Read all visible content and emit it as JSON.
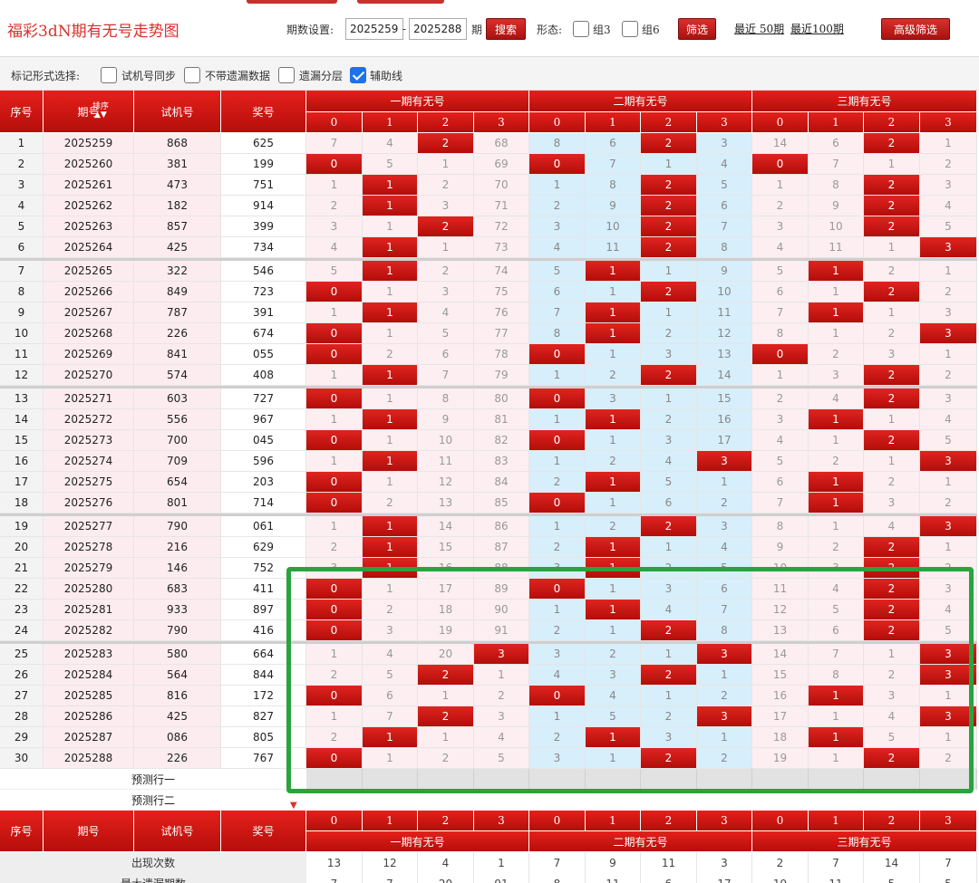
{
  "title": "福彩3dN期有无号走势图",
  "controls": {
    "period_label": "期数设置:",
    "start_period": "2025259",
    "dash": "-",
    "end_period": "2025288",
    "period_unit": "期",
    "search_button": "搜索",
    "shape_label": "形态:",
    "group3_label": "组3",
    "group6_label": "组6",
    "filter_button": "筛选",
    "recent50": "最近 50期",
    "recent100": "最近100期",
    "advanced_filter": "高级筛选"
  },
  "markbar": {
    "label": "标记形式选择:",
    "option_sync": "试机号同步",
    "option_no_missing": "不带遗漏数据",
    "option_layered": "遗漏分层",
    "option_helper": "辅助线",
    "helper_checked": true
  },
  "header": {
    "idx": "序号",
    "issue": "期号",
    "sort": "排序",
    "test": "试机号",
    "prize": "奖号",
    "group1": "一期有无号",
    "group2": "二期有无号",
    "group3": "三期有无号",
    "cols": [
      "0",
      "1",
      "2",
      "3",
      "0",
      "1",
      "2",
      "3",
      "0",
      "1",
      "2",
      "3"
    ]
  },
  "rows": [
    {
      "idx": "1",
      "issue": "2025259",
      "test": "868",
      "prize": "625",
      "v": [
        "7",
        "4",
        "2",
        "68",
        "8",
        "6",
        "2",
        "3",
        "14",
        "6",
        "2",
        "1"
      ],
      "hit": [
        0,
        0,
        1,
        0,
        0,
        0,
        1,
        0,
        0,
        0,
        1,
        0
      ]
    },
    {
      "idx": "2",
      "issue": "2025260",
      "test": "381",
      "prize": "199",
      "v": [
        "0",
        "5",
        "1",
        "69",
        "0",
        "7",
        "1",
        "4",
        "0",
        "7",
        "1",
        "2"
      ],
      "hit": [
        1,
        0,
        0,
        0,
        1,
        0,
        0,
        0,
        1,
        0,
        0,
        0
      ]
    },
    {
      "idx": "3",
      "issue": "2025261",
      "test": "473",
      "prize": "751",
      "v": [
        "1",
        "1",
        "2",
        "70",
        "1",
        "8",
        "2",
        "5",
        "1",
        "8",
        "2",
        "3"
      ],
      "hit": [
        0,
        1,
        0,
        0,
        0,
        0,
        1,
        0,
        0,
        0,
        1,
        0
      ]
    },
    {
      "idx": "4",
      "issue": "2025262",
      "test": "182",
      "prize": "914",
      "v": [
        "2",
        "1",
        "3",
        "71",
        "2",
        "9",
        "2",
        "6",
        "2",
        "9",
        "2",
        "4"
      ],
      "hit": [
        0,
        1,
        0,
        0,
        0,
        0,
        1,
        0,
        0,
        0,
        1,
        0
      ]
    },
    {
      "idx": "5",
      "issue": "2025263",
      "test": "857",
      "prize": "399",
      "v": [
        "3",
        "1",
        "2",
        "72",
        "3",
        "10",
        "2",
        "7",
        "3",
        "10",
        "2",
        "5"
      ],
      "hit": [
        0,
        0,
        1,
        0,
        0,
        0,
        1,
        0,
        0,
        0,
        1,
        0
      ]
    },
    {
      "idx": "6",
      "issue": "2025264",
      "test": "425",
      "prize": "734",
      "v": [
        "4",
        "1",
        "1",
        "73",
        "4",
        "11",
        "2",
        "8",
        "4",
        "11",
        "1",
        "3"
      ],
      "hit": [
        0,
        1,
        0,
        0,
        0,
        0,
        1,
        0,
        0,
        0,
        0,
        1
      ]
    },
    {
      "idx": "7",
      "issue": "2025265",
      "test": "322",
      "prize": "546",
      "v": [
        "5",
        "1",
        "2",
        "74",
        "5",
        "1",
        "1",
        "9",
        "5",
        "1",
        "2",
        "1"
      ],
      "hit": [
        0,
        1,
        0,
        0,
        0,
        1,
        0,
        0,
        0,
        1,
        0,
        0
      ]
    },
    {
      "idx": "8",
      "issue": "2025266",
      "test": "849",
      "prize": "723",
      "v": [
        "0",
        "1",
        "3",
        "75",
        "6",
        "1",
        "2",
        "10",
        "6",
        "1",
        "2",
        "2"
      ],
      "hit": [
        1,
        0,
        0,
        0,
        0,
        0,
        1,
        0,
        0,
        0,
        1,
        0
      ]
    },
    {
      "idx": "9",
      "issue": "2025267",
      "test": "787",
      "prize": "391",
      "v": [
        "1",
        "1",
        "4",
        "76",
        "7",
        "1",
        "1",
        "11",
        "7",
        "1",
        "1",
        "3"
      ],
      "hit": [
        0,
        1,
        0,
        0,
        0,
        1,
        0,
        0,
        0,
        1,
        0,
        0
      ]
    },
    {
      "idx": "10",
      "issue": "2025268",
      "test": "226",
      "prize": "674",
      "v": [
        "0",
        "1",
        "5",
        "77",
        "8",
        "1",
        "2",
        "12",
        "8",
        "1",
        "2",
        "3"
      ],
      "hit": [
        1,
        0,
        0,
        0,
        0,
        1,
        0,
        0,
        0,
        0,
        0,
        1
      ]
    },
    {
      "idx": "11",
      "issue": "2025269",
      "test": "841",
      "prize": "055",
      "v": [
        "0",
        "2",
        "6",
        "78",
        "0",
        "1",
        "3",
        "13",
        "0",
        "2",
        "3",
        "1"
      ],
      "hit": [
        1,
        0,
        0,
        0,
        1,
        0,
        0,
        0,
        1,
        0,
        0,
        0
      ]
    },
    {
      "idx": "12",
      "issue": "2025270",
      "test": "574",
      "prize": "408",
      "v": [
        "1",
        "1",
        "7",
        "79",
        "1",
        "2",
        "2",
        "14",
        "1",
        "3",
        "2",
        "2"
      ],
      "hit": [
        0,
        1,
        0,
        0,
        0,
        0,
        1,
        0,
        0,
        0,
        1,
        0
      ]
    },
    {
      "idx": "13",
      "issue": "2025271",
      "test": "603",
      "prize": "727",
      "v": [
        "0",
        "1",
        "8",
        "80",
        "0",
        "3",
        "1",
        "15",
        "2",
        "4",
        "2",
        "3"
      ],
      "hit": [
        1,
        0,
        0,
        0,
        1,
        0,
        0,
        0,
        0,
        0,
        1,
        0
      ]
    },
    {
      "idx": "14",
      "issue": "2025272",
      "test": "556",
      "prize": "967",
      "v": [
        "1",
        "1",
        "9",
        "81",
        "1",
        "1",
        "2",
        "16",
        "3",
        "1",
        "1",
        "4"
      ],
      "hit": [
        0,
        1,
        0,
        0,
        0,
        1,
        0,
        0,
        0,
        1,
        0,
        0
      ]
    },
    {
      "idx": "15",
      "issue": "2025273",
      "test": "700",
      "prize": "045",
      "v": [
        "0",
        "1",
        "10",
        "82",
        "0",
        "1",
        "3",
        "17",
        "4",
        "1",
        "2",
        "5"
      ],
      "hit": [
        1,
        0,
        0,
        0,
        1,
        0,
        0,
        0,
        0,
        0,
        1,
        0
      ]
    },
    {
      "idx": "16",
      "issue": "2025274",
      "test": "709",
      "prize": "596",
      "v": [
        "1",
        "1",
        "11",
        "83",
        "1",
        "2",
        "4",
        "3",
        "5",
        "2",
        "1",
        "3"
      ],
      "hit": [
        0,
        1,
        0,
        0,
        0,
        0,
        0,
        1,
        0,
        0,
        0,
        1
      ]
    },
    {
      "idx": "17",
      "issue": "2025275",
      "test": "654",
      "prize": "203",
      "v": [
        "0",
        "1",
        "12",
        "84",
        "2",
        "1",
        "5",
        "1",
        "6",
        "1",
        "2",
        "1"
      ],
      "hit": [
        1,
        0,
        0,
        0,
        0,
        1,
        0,
        0,
        0,
        1,
        0,
        0
      ]
    },
    {
      "idx": "18",
      "issue": "2025276",
      "test": "801",
      "prize": "714",
      "v": [
        "0",
        "2",
        "13",
        "85",
        "0",
        "1",
        "6",
        "2",
        "7",
        "1",
        "3",
        "2"
      ],
      "hit": [
        1,
        0,
        0,
        0,
        1,
        0,
        0,
        0,
        0,
        1,
        0,
        0
      ]
    },
    {
      "idx": "19",
      "issue": "2025277",
      "test": "790",
      "prize": "061",
      "v": [
        "1",
        "1",
        "14",
        "86",
        "1",
        "2",
        "2",
        "3",
        "8",
        "1",
        "4",
        "3"
      ],
      "hit": [
        0,
        1,
        0,
        0,
        0,
        0,
        1,
        0,
        0,
        0,
        0,
        1
      ]
    },
    {
      "idx": "20",
      "issue": "2025278",
      "test": "216",
      "prize": "629",
      "v": [
        "2",
        "1",
        "15",
        "87",
        "2",
        "1",
        "1",
        "4",
        "9",
        "2",
        "2",
        "1"
      ],
      "hit": [
        0,
        1,
        0,
        0,
        0,
        1,
        0,
        0,
        0,
        0,
        1,
        0
      ]
    },
    {
      "idx": "21",
      "issue": "2025279",
      "test": "146",
      "prize": "752",
      "v": [
        "3",
        "1",
        "16",
        "88",
        "3",
        "1",
        "2",
        "5",
        "10",
        "3",
        "2",
        "2"
      ],
      "hit": [
        0,
        1,
        0,
        0,
        0,
        1,
        0,
        0,
        0,
        0,
        1,
        0
      ]
    },
    {
      "idx": "22",
      "issue": "2025280",
      "test": "683",
      "prize": "411",
      "v": [
        "0",
        "1",
        "17",
        "89",
        "0",
        "1",
        "3",
        "6",
        "11",
        "4",
        "2",
        "3"
      ],
      "hit": [
        1,
        0,
        0,
        0,
        1,
        0,
        0,
        0,
        0,
        0,
        1,
        0
      ]
    },
    {
      "idx": "23",
      "issue": "2025281",
      "test": "933",
      "prize": "897",
      "v": [
        "0",
        "2",
        "18",
        "90",
        "1",
        "1",
        "4",
        "7",
        "12",
        "5",
        "2",
        "4"
      ],
      "hit": [
        1,
        0,
        0,
        0,
        0,
        1,
        0,
        0,
        0,
        0,
        1,
        0
      ]
    },
    {
      "idx": "24",
      "issue": "2025282",
      "test": "790",
      "prize": "416",
      "v": [
        "0",
        "3",
        "19",
        "91",
        "2",
        "1",
        "2",
        "8",
        "13",
        "6",
        "2",
        "5"
      ],
      "hit": [
        1,
        0,
        0,
        0,
        0,
        0,
        1,
        0,
        0,
        0,
        1,
        0
      ]
    },
    {
      "idx": "25",
      "issue": "2025283",
      "test": "580",
      "prize": "664",
      "v": [
        "1",
        "4",
        "20",
        "3",
        "3",
        "2",
        "1",
        "3",
        "14",
        "7",
        "1",
        "3"
      ],
      "hit": [
        0,
        0,
        0,
        1,
        0,
        0,
        0,
        1,
        0,
        0,
        0,
        1
      ]
    },
    {
      "idx": "26",
      "issue": "2025284",
      "test": "564",
      "prize": "844",
      "v": [
        "2",
        "5",
        "2",
        "1",
        "4",
        "3",
        "2",
        "1",
        "15",
        "8",
        "2",
        "3"
      ],
      "hit": [
        0,
        0,
        1,
        0,
        0,
        0,
        1,
        0,
        0,
        0,
        0,
        1
      ]
    },
    {
      "idx": "27",
      "issue": "2025285",
      "test": "816",
      "prize": "172",
      "v": [
        "0",
        "6",
        "1",
        "2",
        "0",
        "4",
        "1",
        "2",
        "16",
        "1",
        "3",
        "1"
      ],
      "hit": [
        1,
        0,
        0,
        0,
        1,
        0,
        0,
        0,
        0,
        1,
        0,
        0
      ]
    },
    {
      "idx": "28",
      "issue": "2025286",
      "test": "425",
      "prize": "827",
      "v": [
        "1",
        "7",
        "2",
        "3",
        "1",
        "5",
        "2",
        "3",
        "17",
        "1",
        "4",
        "3"
      ],
      "hit": [
        0,
        0,
        1,
        0,
        0,
        0,
        0,
        1,
        0,
        0,
        0,
        1
      ]
    },
    {
      "idx": "29",
      "issue": "2025287",
      "test": "086",
      "prize": "805",
      "v": [
        "2",
        "1",
        "1",
        "4",
        "2",
        "1",
        "3",
        "1",
        "18",
        "1",
        "5",
        "1"
      ],
      "hit": [
        0,
        1,
        0,
        0,
        0,
        1,
        0,
        0,
        0,
        1,
        0,
        0
      ]
    },
    {
      "idx": "30",
      "issue": "2025288",
      "test": "226",
      "prize": "767",
      "v": [
        "0",
        "1",
        "2",
        "5",
        "3",
        "1",
        "2",
        "2",
        "19",
        "1",
        "2",
        "2"
      ],
      "hit": [
        1,
        0,
        0,
        0,
        0,
        0,
        1,
        0,
        0,
        0,
        1,
        0
      ]
    }
  ],
  "predict": {
    "row1": "预测行一",
    "row2": "预测行二"
  },
  "footer": {
    "idx": "序号",
    "issue": "期号",
    "test": "试机号",
    "prize": "奖号",
    "cols": [
      "0",
      "1",
      "2",
      "3",
      "0",
      "1",
      "2",
      "3",
      "0",
      "1",
      "2",
      "3"
    ],
    "group1": "一期有无号",
    "group2": "二期有无号",
    "group3": "三期有无号",
    "occur_label": "出现次数",
    "occur": [
      "13",
      "12",
      "4",
      "1",
      "7",
      "9",
      "11",
      "3",
      "2",
      "7",
      "14",
      "7"
    ],
    "maxmiss_label": "最大遗漏期数",
    "maxmiss": [
      "7",
      "7",
      "20",
      "91",
      "8",
      "11",
      "6",
      "17",
      "19",
      "11",
      "5",
      "5"
    ]
  },
  "colors": {
    "accent": "#d9302c",
    "hit": "#c8110d",
    "blue_band": "#d7eefb",
    "highlight": "#2aa33f"
  }
}
